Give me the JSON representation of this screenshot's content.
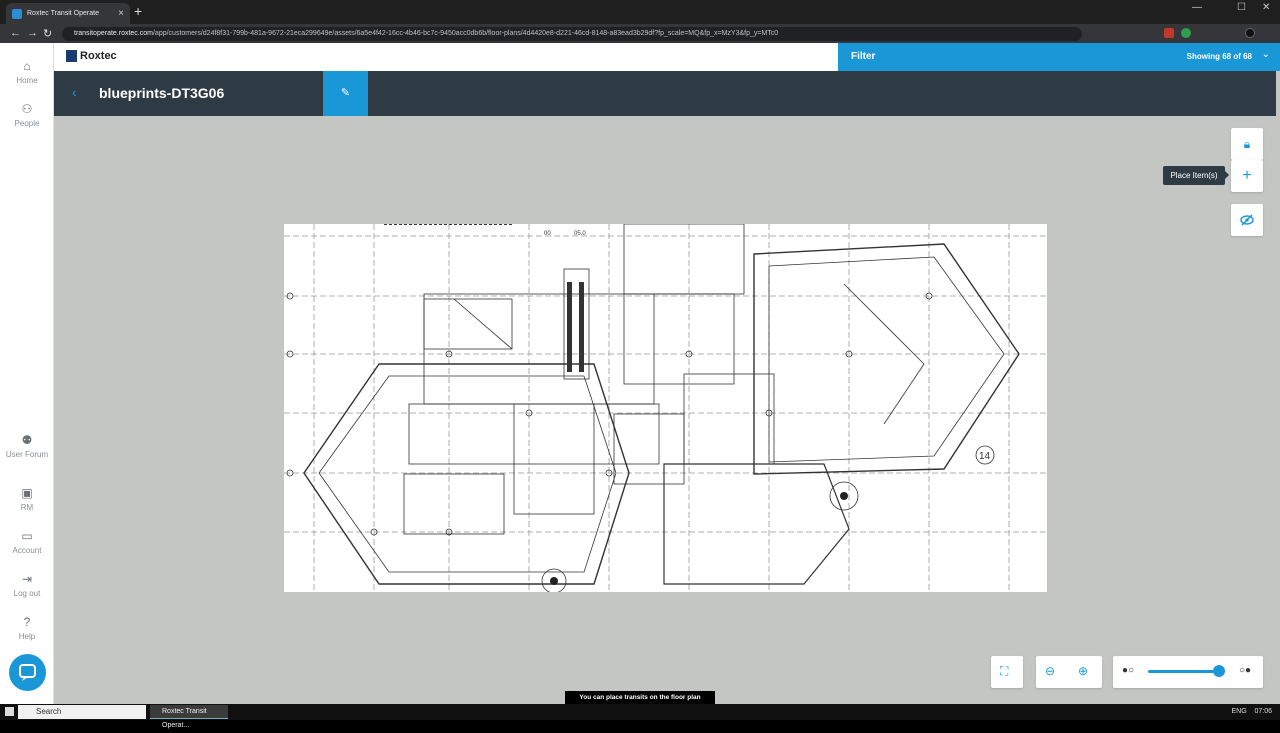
{
  "browser": {
    "tab_title": "Roxtec Transit Operate",
    "url_host": "transitoperate.roxtec.com",
    "url_path": "/app/customers/d24f8f31-799b-481a-9672-21eca299649e/assets/6a5e4f42-16cc-4b46-bc7c-9450acc0db6b/floor-plans/4d4420e8-d221-46cd-8148-a83ead3b29df?fp_scale=MQ&fp_x=MzY3&fp_y=MTc0"
  },
  "app": {
    "logo_text": "Roxtec",
    "filter_label": "Filter",
    "showing_text": "Showing 68 of 68",
    "page_title": "blueprints-DT3G06"
  },
  "sidebar": {
    "items": [
      {
        "label": "Home",
        "icon": "home-icon"
      },
      {
        "label": "People",
        "icon": "people-icon"
      },
      {
        "label": "User Forum",
        "icon": "forum-icon"
      },
      {
        "label": "RM",
        "icon": "rm-icon"
      },
      {
        "label": "Account",
        "icon": "card-icon"
      },
      {
        "label": "Log out",
        "icon": "logout-icon"
      },
      {
        "label": "Help",
        "icon": "help-icon"
      }
    ]
  },
  "tools": {
    "tooltip": "Place Item(s)"
  },
  "floorplan": {
    "room_label": "14",
    "room_labels": [
      "05.0",
      "00"
    ]
  },
  "status_text": "You can place transits on the floor plan",
  "taskbar": {
    "search_placeholder": "Search",
    "app_label": "Roxtec Transit Operat...",
    "lang": "ENG",
    "time": "07:06"
  },
  "colors": {
    "accent": "#1a97d6",
    "dark": "#2e3b44",
    "canvas": "#c4c6c3"
  }
}
